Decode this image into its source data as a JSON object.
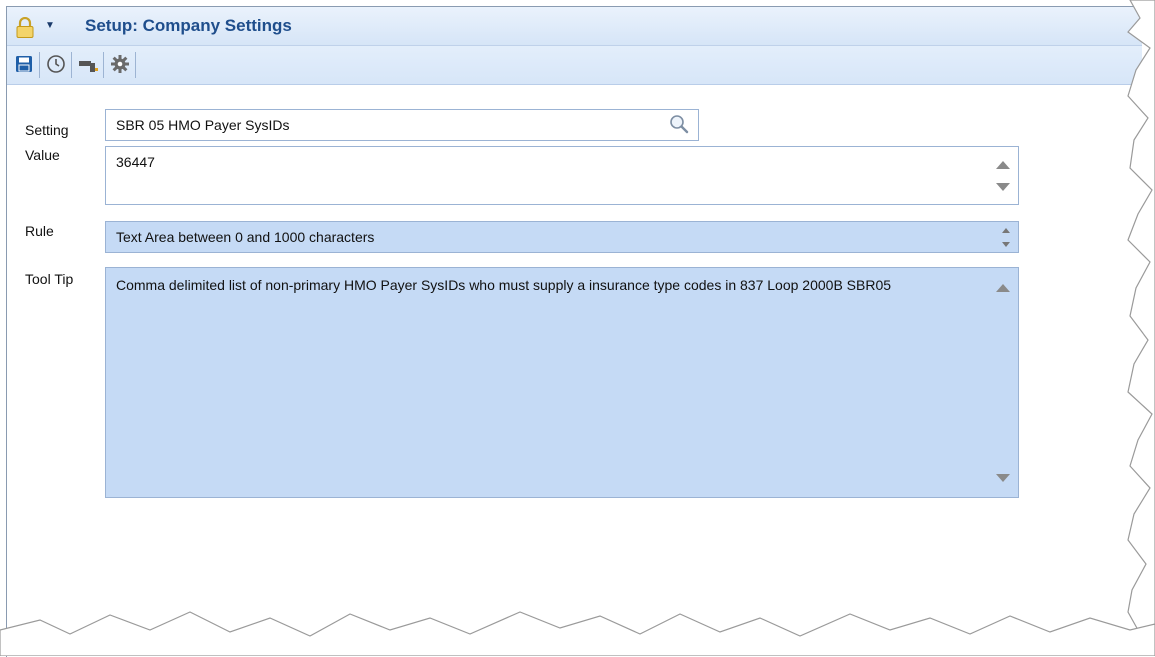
{
  "window": {
    "title": "Setup: Company Settings",
    "icons": {
      "lock": "lock-icon",
      "menu": "chevron-down-icon"
    }
  },
  "toolbar": {
    "buttons": [
      {
        "name": "save-button",
        "icon": "save-icon"
      },
      {
        "name": "history-button",
        "icon": "clock-icon"
      },
      {
        "name": "manage-button",
        "icon": "gavel-icon"
      },
      {
        "name": "settings-button",
        "icon": "gear-icon"
      }
    ]
  },
  "form": {
    "setting": {
      "label": "Setting",
      "value": "SBR 05 HMO Payer SysIDs"
    },
    "value": {
      "label": "Value",
      "value": "36447"
    },
    "rule": {
      "label": "Rule",
      "value": "Text Area between 0 and 1000 characters"
    },
    "tooltip": {
      "label": "Tool Tip",
      "value": "Comma delimited list of non-primary HMO Payer SysIDs who must supply a insurance type codes in 837 Loop 2000B SBR05"
    }
  },
  "colors": {
    "title": "#1f4e8c",
    "toolbar_bg": "#dbe8f8",
    "readonly_bg": "#c5daf5",
    "field_border": "#9bb3d4"
  }
}
